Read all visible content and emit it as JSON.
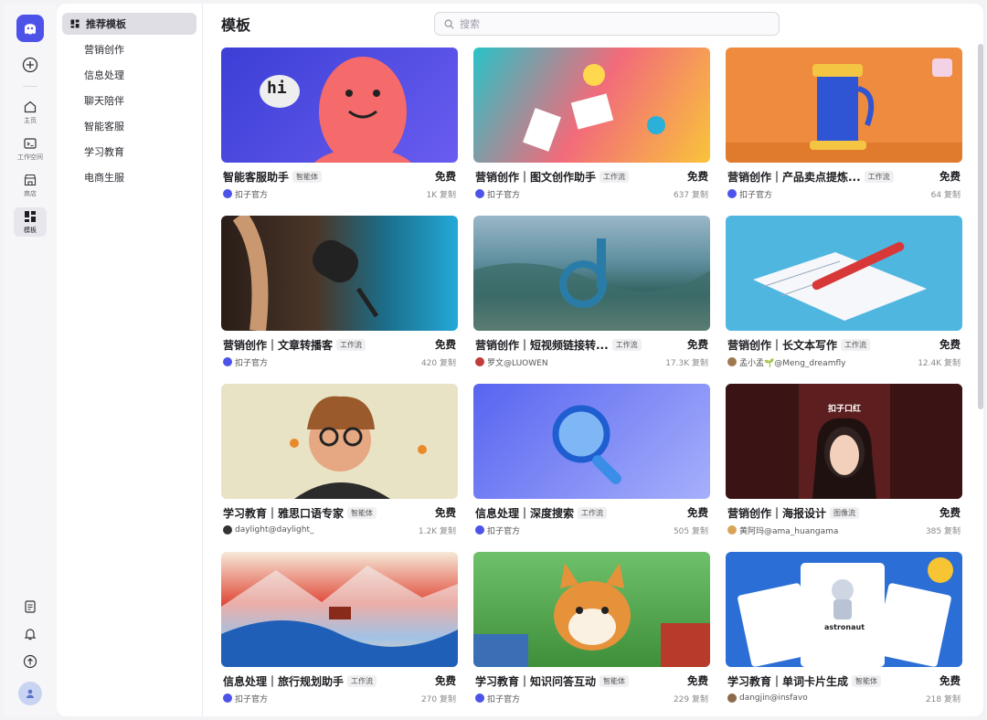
{
  "rail": {
    "items": [
      {
        "label": "主页",
        "icon": "home-icon"
      },
      {
        "label": "工作空间",
        "icon": "workspace-icon"
      },
      {
        "label": "商店",
        "icon": "store-icon"
      },
      {
        "label": "模板",
        "icon": "template-icon"
      }
    ]
  },
  "categories": [
    {
      "label": "推荐模板"
    },
    {
      "label": "营销创作"
    },
    {
      "label": "信息处理"
    },
    {
      "label": "聊天陪伴"
    },
    {
      "label": "智能客服"
    },
    {
      "label": "学习教育"
    },
    {
      "label": "电商生服"
    }
  ],
  "header": {
    "title": "模板",
    "search_placeholder": "搜索"
  },
  "cards": [
    {
      "name": "智能客服助手",
      "badge": "智能体",
      "price": "免费",
      "author": "扣子官方",
      "copies": "1K 复制"
    },
    {
      "name": "营销创作｜图文创作助手",
      "badge": "工作流",
      "price": "免费",
      "author": "扣子官方",
      "copies": "637 复制"
    },
    {
      "name": "营销创作｜产品卖点提炼...",
      "badge": "工作流",
      "price": "免费",
      "author": "扣子官方",
      "copies": "64 复制"
    },
    {
      "name": "营销创作｜文章转播客",
      "badge": "工作流",
      "price": "免费",
      "author": "扣子官方",
      "copies": "420 复制"
    },
    {
      "name": "营销创作｜短视频链接转...",
      "badge": "工作流",
      "price": "免费",
      "author": "罗文@LUOWEN",
      "copies": "17.3K 复制"
    },
    {
      "name": "营销创作｜长文本写作",
      "badge": "工作流",
      "price": "免费",
      "author": "孟小孟🌱@Meng_dreamfly",
      "copies": "12.4K 复制"
    },
    {
      "name": "学习教育｜雅思口语专家",
      "badge": "智能体",
      "price": "免费",
      "author": "daylight@daylight_",
      "copies": "1.2K 复制"
    },
    {
      "name": "信息处理｜深度搜索",
      "badge": "工作流",
      "price": "免费",
      "author": "扣子官方",
      "copies": "505 复制"
    },
    {
      "name": "营销创作｜海报设计",
      "badge": "图像流",
      "price": "免费",
      "author": "黄阿玛@ama_huangama",
      "copies": "385 复制"
    },
    {
      "name": "信息处理｜旅行规划助手",
      "badge": "工作流",
      "price": "免费",
      "author": "扣子官方",
      "copies": "270 复制"
    },
    {
      "name": "学习教育｜知识问答互动",
      "badge": "智能体",
      "price": "免费",
      "author": "扣子官方",
      "copies": "229 复制"
    },
    {
      "name": "学习教育｜单词卡片生成",
      "badge": "智能体",
      "price": "免费",
      "author": "dangjin@insfavo",
      "copies": "218 复制"
    }
  ],
  "thumbs": {
    "t1_text": "hi",
    "t9_text": "扣子口红",
    "t12_text": "astronaut"
  },
  "colors": {
    "accent": "#4d53e8"
  }
}
